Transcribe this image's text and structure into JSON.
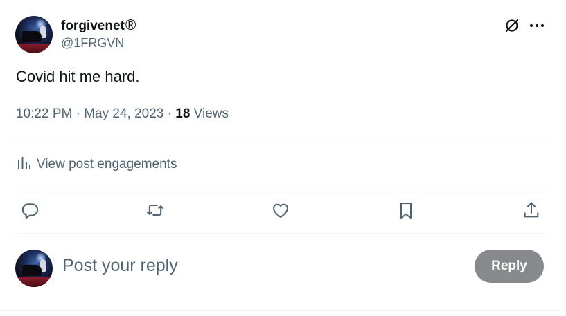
{
  "author": {
    "display_name": "forgivenet",
    "badge": "®",
    "handle": "@1FRGVN"
  },
  "tweet": {
    "text": "Covid hit me hard.",
    "time": "10:22 PM",
    "date": "May 24, 2023",
    "view_count": "18",
    "views_label": "Views",
    "separator": "·"
  },
  "engagements": {
    "label": "View post engagements"
  },
  "composer": {
    "placeholder": "Post your reply",
    "reply_label": "Reply"
  },
  "icons": {
    "grok": "grok-icon",
    "more": "more-icon",
    "analytics": "analytics-icon",
    "reply": "reply-icon",
    "repost": "repost-icon",
    "like": "heart-icon",
    "bookmark": "bookmark-icon",
    "share": "share-icon"
  },
  "colors": {
    "text_primary": "#0f1419",
    "text_secondary": "#536471",
    "divider": "#eff3f4",
    "reply_button": "#87898c"
  }
}
